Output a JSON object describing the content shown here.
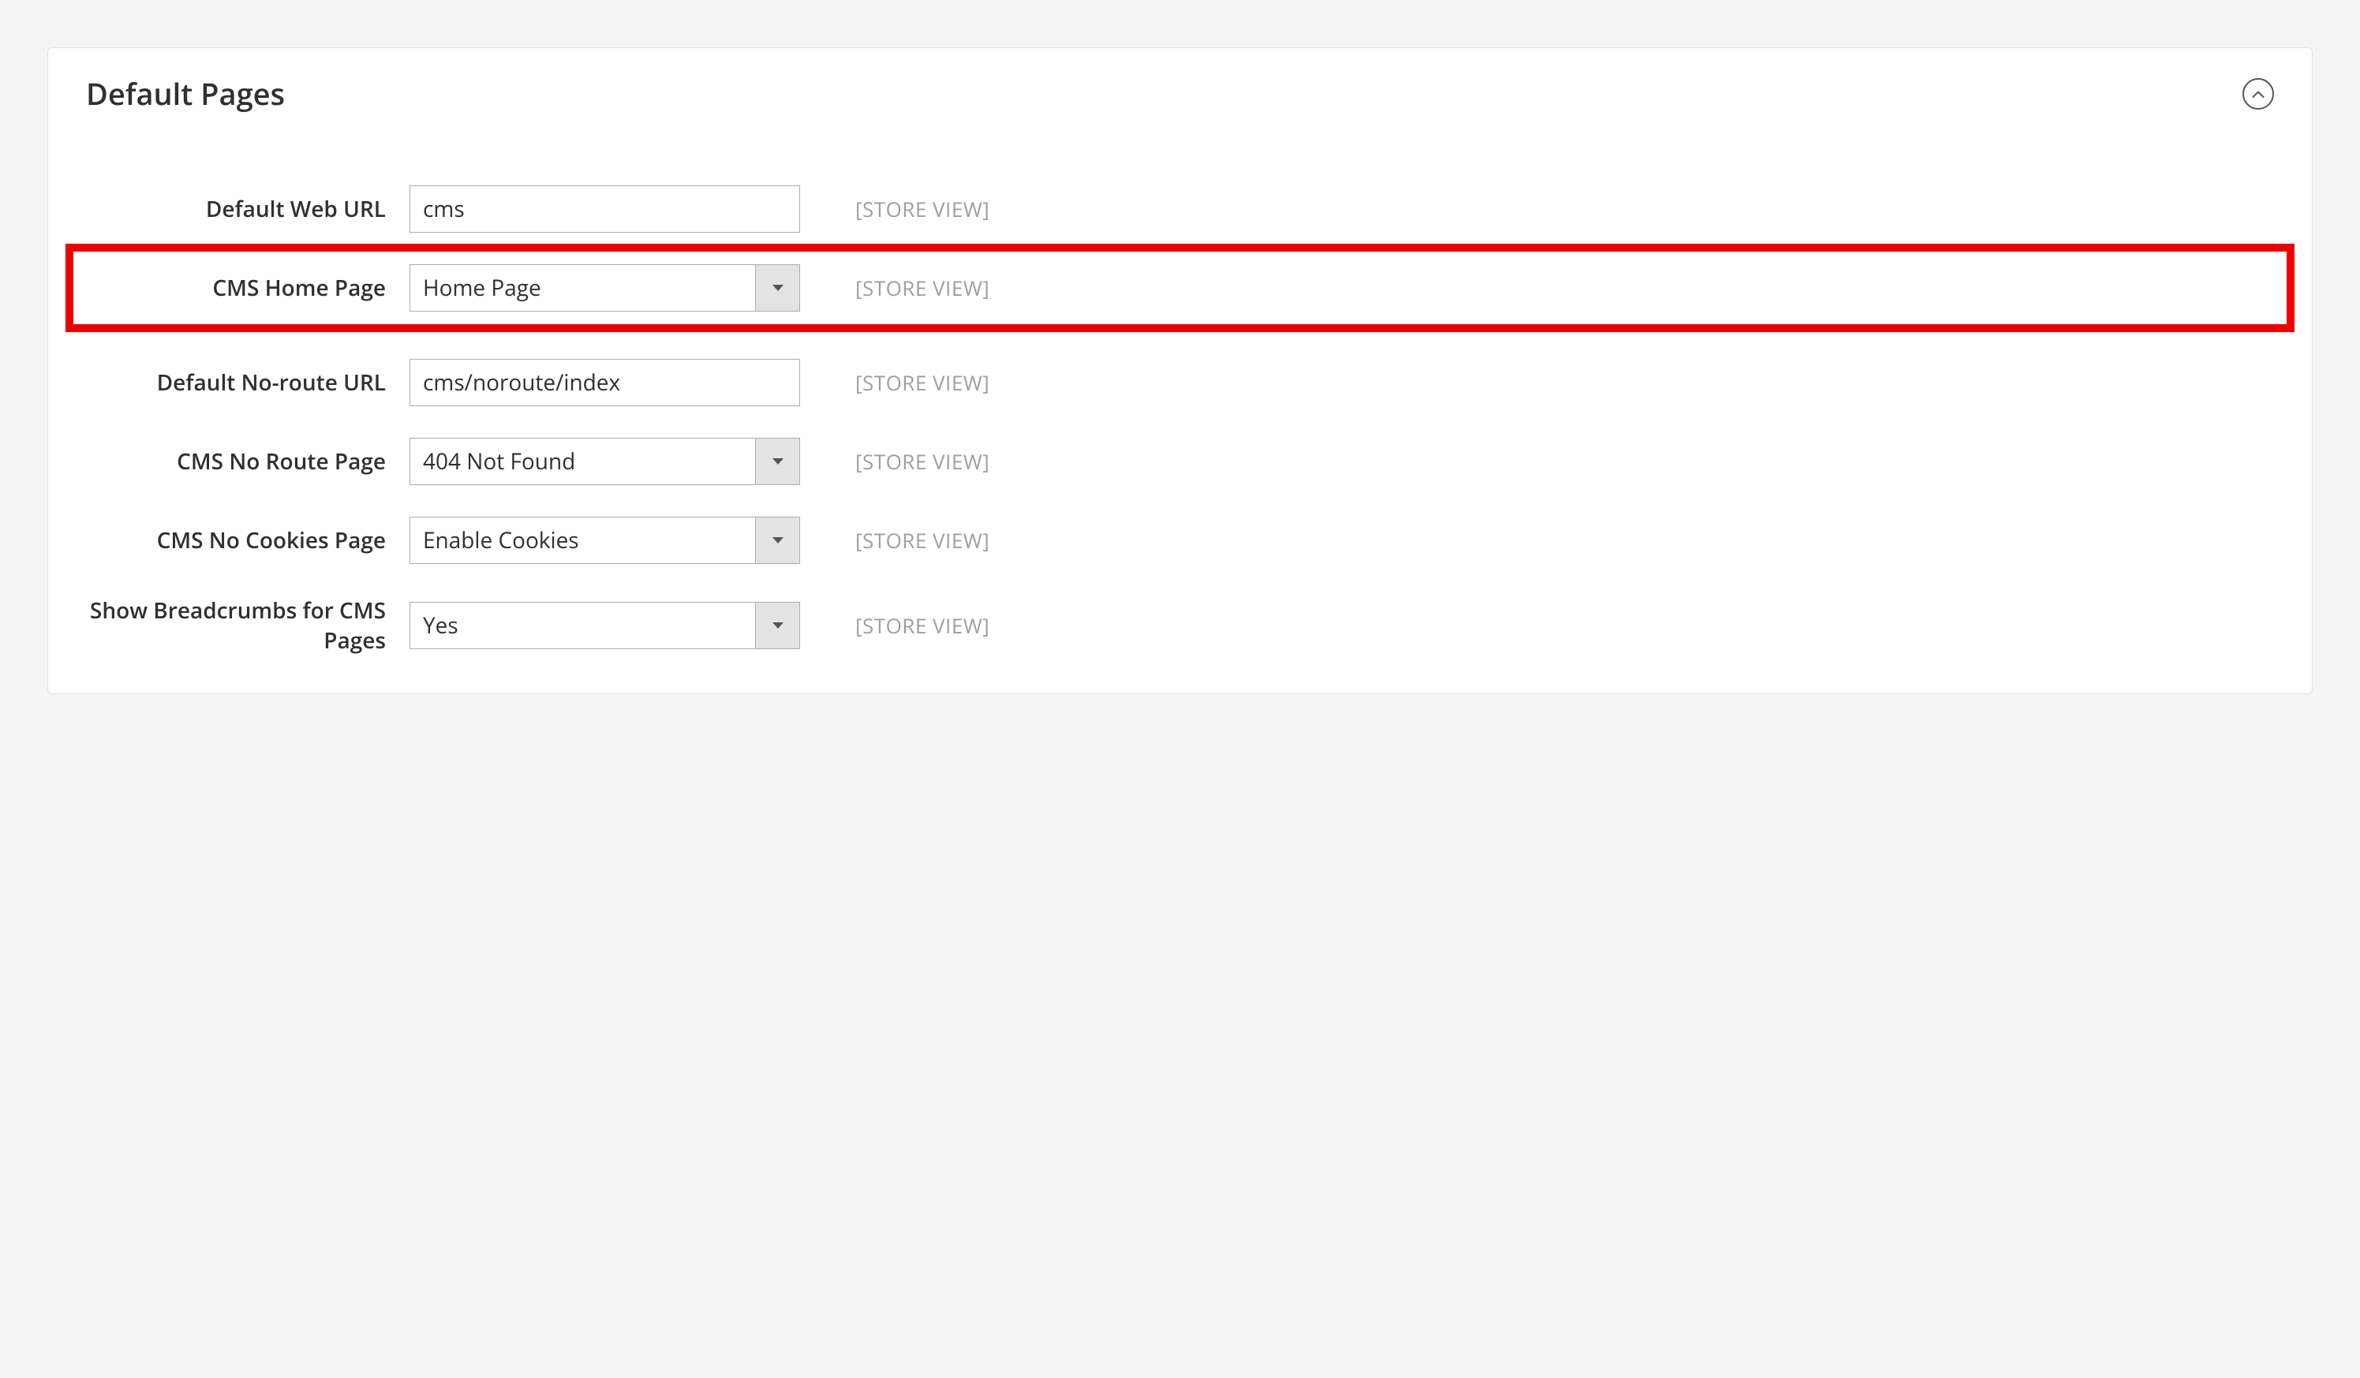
{
  "panel": {
    "title": "Default Pages",
    "rows": [
      {
        "label": "Default Web URL",
        "type": "text",
        "value": "cms",
        "scope": "[STORE VIEW]",
        "highlighted": false
      },
      {
        "label": "CMS Home Page",
        "type": "select",
        "value": "Home Page",
        "scope": "[STORE VIEW]",
        "highlighted": true
      },
      {
        "label": "Default No-route URL",
        "type": "text",
        "value": "cms/noroute/index",
        "scope": "[STORE VIEW]",
        "highlighted": false
      },
      {
        "label": "CMS No Route Page",
        "type": "select",
        "value": "404 Not Found",
        "scope": "[STORE VIEW]",
        "highlighted": false
      },
      {
        "label": "CMS No Cookies Page",
        "type": "select",
        "value": "Enable Cookies",
        "scope": "[STORE VIEW]",
        "highlighted": false
      },
      {
        "label": "Show Breadcrumbs for CMS Pages",
        "type": "select",
        "value": "Yes",
        "scope": "[STORE VIEW]",
        "highlighted": false
      }
    ]
  }
}
